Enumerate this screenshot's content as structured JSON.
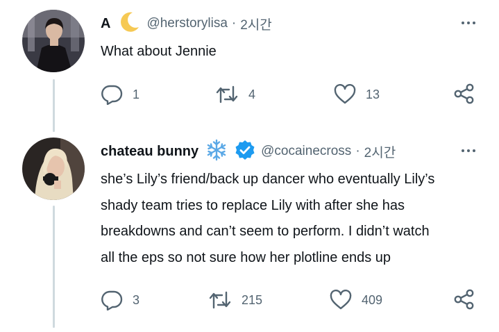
{
  "tweets": [
    {
      "name": "A",
      "handle": "@herstorylisa",
      "separator": "·",
      "time": "2시간",
      "name_emoji": "crescent-moon",
      "verified": false,
      "text": "What about Jennie",
      "replies": "1",
      "retweets": "4",
      "likes": "13"
    },
    {
      "name": "chateau bunny",
      "handle": "@cocainecross",
      "separator": "·",
      "time": "2시간",
      "name_emoji": "snowflake",
      "verified": true,
      "text_lines": [
        "she’s Lily’s friend/back up dancer who eventually Lily’s",
        "shady team tries to replace Lily with after she has",
        "breakdowns and can’t seem to perform. I didn’t watch",
        "all the eps so not sure how her plotline ends up"
      ],
      "replies": "3",
      "retweets": "215",
      "likes": "409"
    }
  ],
  "colors": {
    "text": "#0f1419",
    "secondary": "#536471",
    "thread_line": "#cfd9de",
    "verified": "#1d9bf0",
    "snowflake": "#5aa8e6",
    "moon": "#f6c954"
  }
}
